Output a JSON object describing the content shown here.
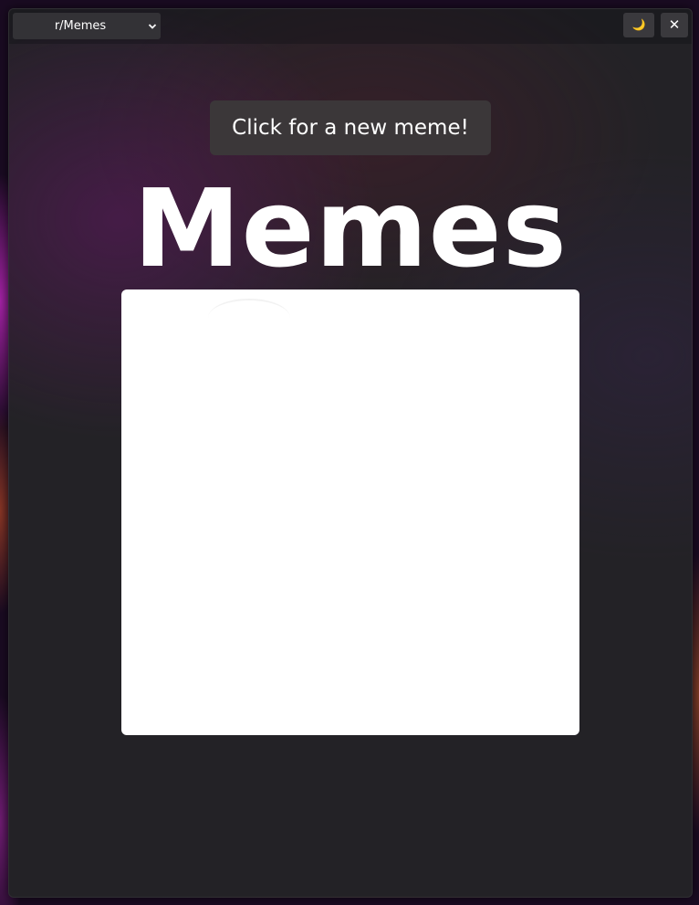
{
  "subreddit_select": {
    "value": "r/Memes"
  },
  "titlebar": {
    "theme_toggle_icon": "moon-icon",
    "theme_toggle_glyph": "🌙",
    "close_glyph": "✕",
    "close_icon": "close-icon"
  },
  "main": {
    "new_meme_button_label": "Click for a new meme!",
    "title": "Memes",
    "meme_image": {
      "content": "blank white image"
    }
  },
  "colors": {
    "window_bg": "#232226",
    "button_bg": "#3b3739",
    "text": "#ffffff",
    "moon": "#f2c94c"
  }
}
